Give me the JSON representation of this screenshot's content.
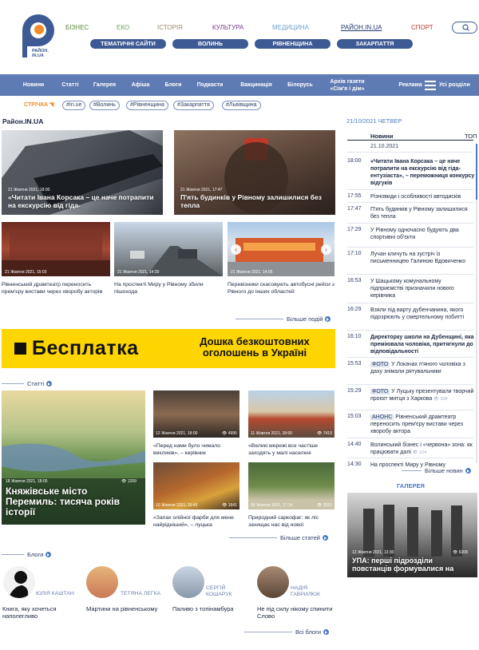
{
  "logo": {
    "letter": "P",
    "text": "РАЙОН.\nIN.UA"
  },
  "topcats": [
    {
      "label": "БІЗНЕС",
      "color": "#5b8a3a"
    },
    {
      "label": "ЕКО",
      "color": "#6aa75c"
    },
    {
      "label": "ІСТОРІЯ",
      "color": "#9e8b6c"
    },
    {
      "label": "КУЛЬТУРА",
      "color": "#7a3a8e"
    },
    {
      "label": "МЕДИЦИНА",
      "color": "#6ea3cf"
    },
    {
      "label": "РАЙОН.IN.UA",
      "color": "#1f3a6f"
    },
    {
      "label": "СПОРТ",
      "color": "#c0392b"
    }
  ],
  "pills": [
    "ТЕМАТИЧНІ САЙТИ",
    "ВОЛИНЬ",
    "РІВНЕНЩИНА",
    "ЗАКАРПАТТЯ"
  ],
  "nav": [
    "Новини",
    "Статті",
    "Галерея",
    "Афіша",
    "Блоги",
    "Подкасти",
    "Вакцинація",
    "Білорусь",
    "Архів газети «Сім'я і дім»",
    "Реклама"
  ],
  "nav_all": "Усі розділи",
  "stream": "СТРІЧКА",
  "tags": [
    "#In.ue",
    "#Волинь",
    "#Рівненщина",
    "#Закарпаття",
    "#Львівщина"
  ],
  "section_title": "Район.IN.UA",
  "main_news": [
    {
      "date": "21 Жовтня 2021, 18:00",
      "title": "«Читати Івана Корсака – це наче потрапити на екскурсію від гіда-"
    },
    {
      "date": "21 Жовтня 2021, 17:47",
      "title": "П'ять будинків у Рівному залишилися без тепла"
    }
  ],
  "row_news": [
    {
      "date": "21 Жовтня 2021, 15:03",
      "title": "Рівненський драмтеатр переносить прем'єру вистави через хворобу акторів"
    },
    {
      "date": "21 Жовтня 2021, 14:30",
      "title": "На проспекті Миру у Рівному збили пішохода"
    },
    {
      "date": "21 Жовтня 2021, 14:05",
      "title": "Перевізники скасовують автобусні рейси з Рівного до інших областей"
    }
  ],
  "more_news": "Більше подій",
  "banner": {
    "brand": "Бесплатка",
    "text": "Дошка безкоштовних оголошень в Україні"
  },
  "articles_title": "Статті",
  "big_article": {
    "date": "18 Жовтня 2021, 18:00",
    "views": "1209",
    "title": "Княжівське місто Перемиль: тисяча років історії"
  },
  "small_articles": [
    {
      "date": "12 Жовтня 2021, 18:00",
      "views": "4995",
      "title": "«Перед нами було чимало викликів», – керівник"
    },
    {
      "date": "11 Жовтня 2021, 18:00",
      "views": "7410",
      "title": "«Великі мережі все частіше заходять у малі населені"
    },
    {
      "date": "10 Жовтня 2021, 16:45",
      "views": "1641",
      "title": "«Запах олійної фарби для мене найрідніший», – луцька"
    },
    {
      "date": "06 Жовтня 2021, 17:14",
      "views": "2626",
      "title": "Природний саркофаг: як ліс захищає нас від нової"
    }
  ],
  "more_articles": "Більше статей",
  "blogs_title": "Блоги",
  "blogs": [
    {
      "name": "ЮЛІЯ КАШТАН",
      "title": "Книга, яку хочеться наполегливо"
    },
    {
      "name": "ТЕТЯНА ЛЕГКА",
      "title": "Мартини на рівненському"
    },
    {
      "name": "СЕРГІЙ КОШАРУК",
      "title": "Паливо з топінамбура"
    },
    {
      "name": "НАДІЯ ГАВРИЛЮК",
      "title": "Не під силу нікому спинити Слово"
    }
  ],
  "more_blogs": "Всі блоги",
  "sidebar": {
    "date": "21/10/2021 ЧЕТВЕР",
    "tab_news": "Новини",
    "tab_top": "ТОП",
    "day": "21.10.2021",
    "feed": [
      {
        "t": "18:00",
        "x": "«Читати Івана Корсака – це наче потрапити на екскурсію від гіда-ентузіаста», – переможниця конкурсу відгуків",
        "bold": true
      },
      {
        "t": "17:55",
        "x": "Різновиди і особливості автодисків",
        "bold": false
      },
      {
        "t": "17:47",
        "x": "П'ять будинків у Рівному залишилися без тепла",
        "bold": false
      },
      {
        "t": "17:29",
        "x": "У Рівному одночасно будують два спортивні об'єкти",
        "bold": false
      },
      {
        "t": "17:10",
        "x": "Лучан кличуть на зустріч із письменницею Галиною Вдовиченко",
        "bold": false
      },
      {
        "t": "16:53",
        "x": "У Шацькому комунальному підприємстві призначили нового керівника",
        "bold": false
      },
      {
        "t": "16:29",
        "x": "Взяли під варту дубенчанина, якого підозрюють у смертельному побитті",
        "bold": false
      },
      {
        "t": "16:10",
        "x": "Директорку школи на Дубенщині, яка преміювала чоловіка, притягнули до відповідальності",
        "bold": true
      },
      {
        "t": "15:53",
        "badge": "ФОТО",
        "x": "У Локачах п'яного чоловіка з даху знімали рятувальники",
        "bold": false
      },
      {
        "t": "15:29",
        "badge": "ФОТО",
        "x": "У Луцьку презентували творчий проєкт митця з Харкова",
        "views": "104",
        "bold": false
      },
      {
        "t": "15:03",
        "badge": "АНОНС",
        "x": "Рівненський драмтеатр переносить прем'єру вистави через хворобу актора",
        "bold": false
      },
      {
        "t": "14:40",
        "x": "Волинський бізнес і «червона» зона: як працювати далі",
        "views": "124",
        "bold": false
      },
      {
        "t": "14:30",
        "x": "На проспекті Миру у Рівному",
        "bold": false
      }
    ],
    "more": "Більше новин",
    "gallery_title": "ГАЛЕРЕЯ",
    "gallery": {
      "date": "12 Жовтня 2021, 13:30",
      "views": "6308",
      "title": "УПА: перші підрозділи повстанців формувалися на"
    }
  },
  "colors": {
    "nav": "#5f7bb4",
    "pill": "#3d5a94",
    "accent": "#4a78c4",
    "orange": "#f28c28",
    "banner": "#ffd500"
  }
}
